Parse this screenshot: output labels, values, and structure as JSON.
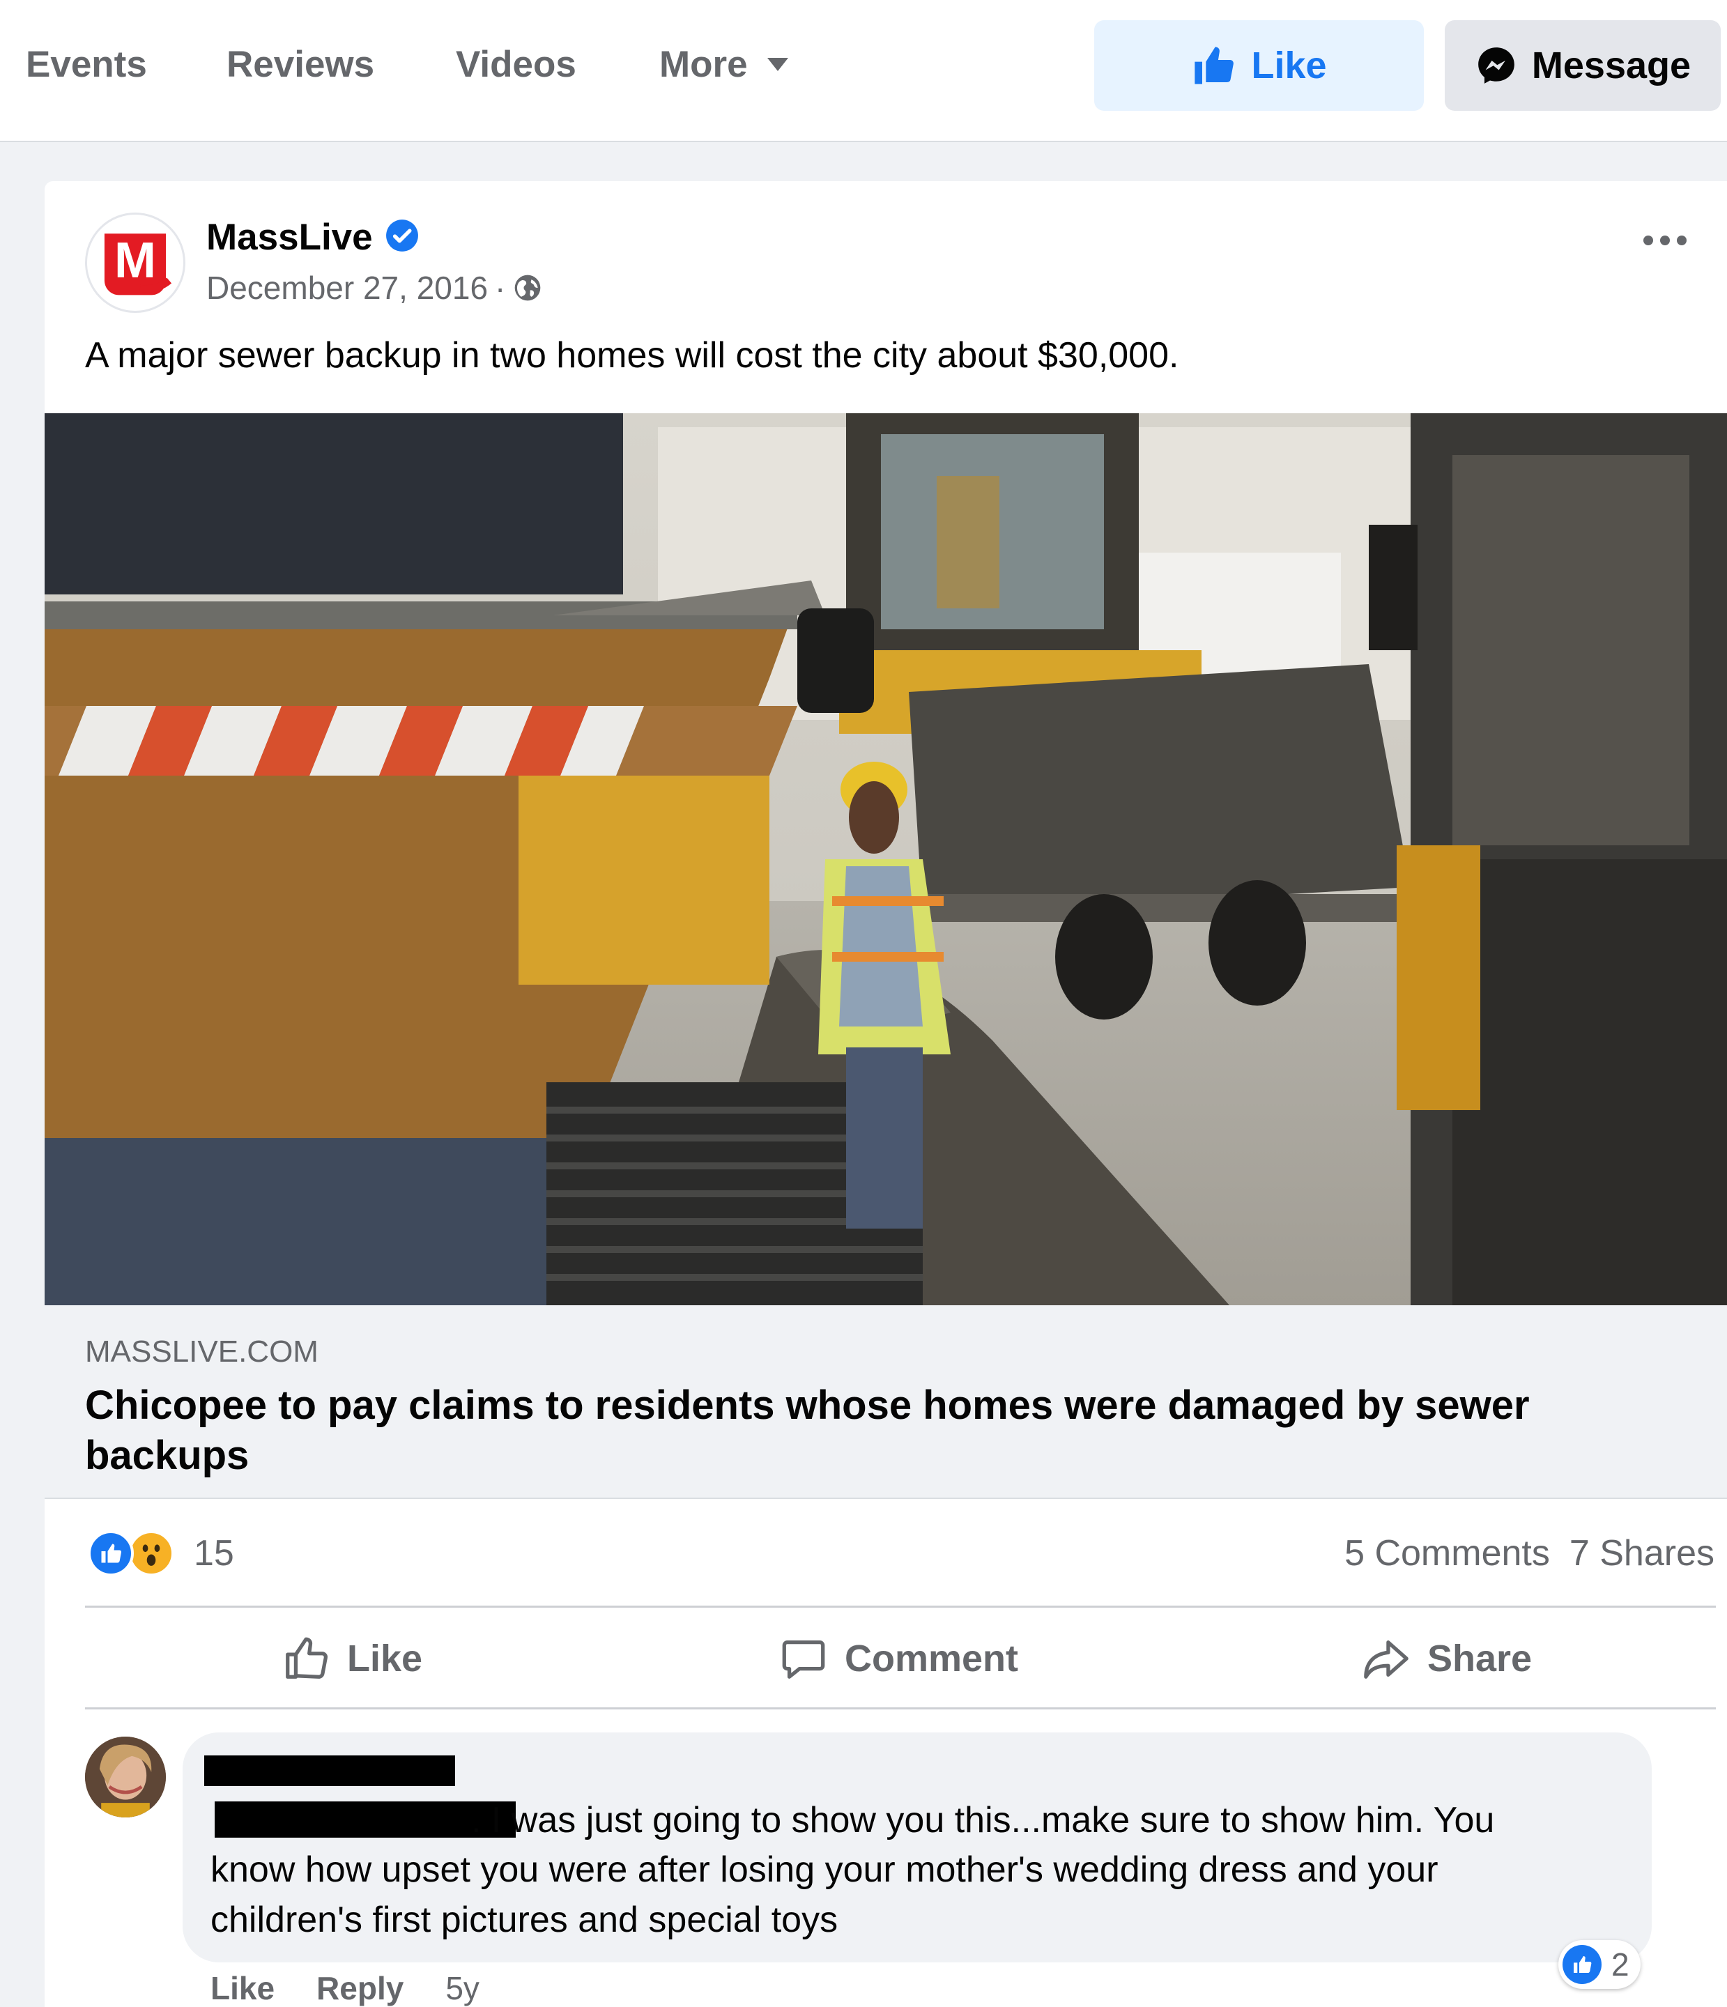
{
  "nav": {
    "tabs": [
      {
        "label": "Events"
      },
      {
        "label": "Reviews"
      },
      {
        "label": "Videos"
      },
      {
        "label": "More"
      }
    ],
    "like_button": "Like",
    "message_button": "Message"
  },
  "colors": {
    "accent": "#1877f2",
    "like_bg": "#e7f3ff",
    "secondary_text": "#65676b",
    "brand_red": "#e31b23"
  },
  "post": {
    "page_name": "MassLive",
    "verified": true,
    "logo_text": "M",
    "date": "December 27, 2016",
    "audience_icon": "globe-icon",
    "text": "A major sewer backup in two homes will cost the city about $30,000.",
    "link": {
      "domain": "MASSLIVE.COM",
      "title": "Chicopee to pay claims to residents whose homes were damaged by sewer backups"
    },
    "reaction_count": "15",
    "comments_count": "5 Comments",
    "shares_count": "7 Shares",
    "actions": {
      "like": "Like",
      "comment": "Comment",
      "share": "Share"
    }
  },
  "comment": {
    "lines": [
      ". I was just going to show you this...make sure to show him. You",
      "know how upset you were after losing your mother's wedding dress and your",
      "children's first pictures and special toys"
    ],
    "like": "Like",
    "reply": "Reply",
    "age": "5y",
    "reaction_count": "2"
  }
}
